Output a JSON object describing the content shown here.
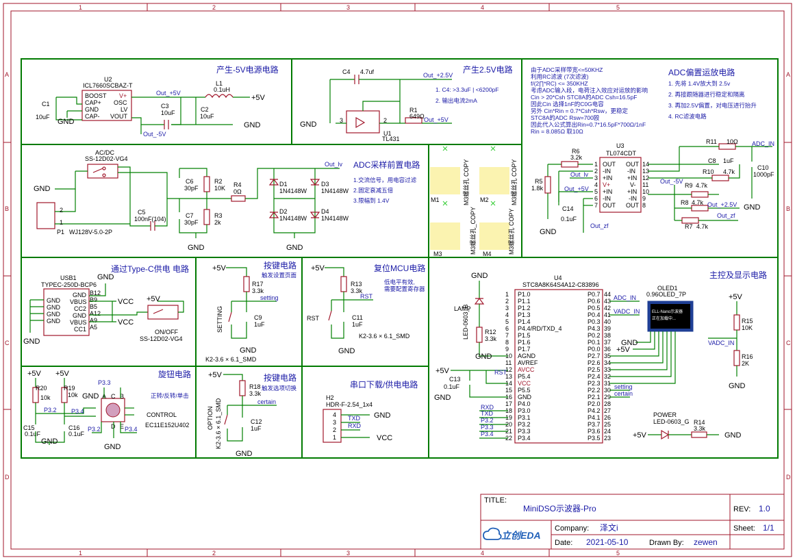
{
  "rulers": {
    "cols": [
      "1",
      "2",
      "3",
      "4",
      "5"
    ],
    "rows": [
      "A",
      "B",
      "C",
      "D"
    ]
  },
  "sections": {
    "neg5v": {
      "title": "产生-5V电源电路",
      "u2_ref": "U2",
      "u2_part": "ICL7660SCBAZ-T",
      "u2_left_pins": [
        "BOOST",
        "CAP+",
        "GND",
        "CAP-"
      ],
      "u2_right_pins": [
        "V+",
        "OSC",
        "LV",
        "VOUT"
      ],
      "c1": "C1",
      "c1_val": "10uF",
      "c3": "C3",
      "c3_val": "10uF",
      "c2": "C2",
      "c2_val": "10uF",
      "l1": "L1",
      "l1_val": "0.1uH",
      "net_out5v": "Out_+5V",
      "net_outm5v": "Out_-5V",
      "plus5v": "+5V",
      "gnd": "GND"
    },
    "v25": {
      "title": "产生2.5V电路",
      "c4": "C4",
      "c4_val": "4.7uf",
      "r1": "R1",
      "r1_val": "649Ω",
      "u1": "U1",
      "u1_part": "TL431",
      "net_out25": "Out_+2.5V",
      "net_out5": "Out_+5V",
      "notes": [
        "1. C4: >3.3uF | <6200pF",
        "2. 输出电流2mA"
      ],
      "gnd": "GND"
    },
    "adc_bias": {
      "title": "ADC偏置运放电路",
      "desc": [
        "由于ADC采样带宽<=50KHZ",
        "利用RC滤波 (7次滤波)",
        "f/(2∏*RC) <= 350KHZ",
        "考虑ADC输入段，电荷注入效应对运放的影响",
        "Cin > 20*Csh  STC8A的ADC Csh=16.5pF",
        "因此Cin 选择1nF的C0G电容",
        "另外 Cin*Rin = 0.7*Csh*Rsw，更稳定",
        "STC8A的ADC Rsw=700殴",
        "因此代入公式算出Rin=0.7*16.5pF*700Ω/1nF",
        "Rin = 8.085Ω  取10Ω"
      ],
      "steps": [
        "1. 先将   1.4V放大到   2.5v",
        "2. 再接跟随器进行稳定和隔离",
        "3. 再加2.5V偏置，对电压进行抬升",
        "4. RC滤波电路"
      ],
      "u3": "U3",
      "u3_part": "TL074CDT",
      "u3_left_pins": [
        [
          "OUT",
          "1"
        ],
        [
          "-IN",
          "2"
        ],
        [
          "+IN",
          "3"
        ],
        [
          "V+",
          "4"
        ],
        [
          "+IN",
          "5"
        ],
        [
          "-IN",
          "6"
        ],
        [
          "OUT",
          "7"
        ]
      ],
      "u3_right_pins": [
        [
          "14",
          "OUT"
        ],
        [
          "13",
          "-IN"
        ],
        [
          "12",
          "+IN"
        ],
        [
          "11",
          "V-"
        ],
        [
          "10",
          "+IN"
        ],
        [
          "9",
          "-IN"
        ],
        [
          "8",
          "OUT"
        ]
      ],
      "r5": "R5",
      "r5_val": "1.8k",
      "r6": "R6",
      "r6_val": "3.2k",
      "r7": "R7",
      "r7_val": "4.7k",
      "r8": "R8",
      "r8_val": "4.7k",
      "r9": "R9",
      "r9_val": "4.7k",
      "r10": "R10",
      "r10_val": "4.7k",
      "r11": "R11",
      "r11_val": "10Ω",
      "c8": "C8",
      "c8_val": "1uF",
      "c10": "C10",
      "c10_val": "1000pF",
      "c14": "C14",
      "c14_val": "0.1uF",
      "net_adcin": "ADC_IN",
      "net_outlv": "Out_lv",
      "net_out5": "Out_+5V",
      "net_outm5": "Out_-5V",
      "net_out25": "Out_+2.5V",
      "net_outzf": "Out_zf",
      "gnd": "GND"
    },
    "adc_front": {
      "title": "ADC采样前置电路",
      "notes": [
        "1.交流信号，用电容过滤",
        "2.固定衰减五倍",
        "3.限幅到     1.4V"
      ],
      "sw": "AC/DC",
      "sw_part": "SS-12D02-VG4",
      "p1": "P1",
      "p1_part": "WJ128V-5.0-2P",
      "c5": "C5",
      "c5_val": "100nF(104)",
      "c6": "C6",
      "c6_val": "30pF",
      "c7": "C7",
      "c7_val": "30pF",
      "r2": "R2",
      "r2_val": "10K",
      "r3": "R3",
      "r3_val": "2k",
      "r4": "R4",
      "r4_val": "0Ω",
      "d1": "D1",
      "d2": "D2",
      "d3": "D3",
      "d4": "D4",
      "d_part": "1N4148W",
      "net_outlv": "Out_lv",
      "gnd": "GND"
    },
    "holes": {
      "m1": "M1",
      "m2": "M2",
      "m3": "M3",
      "m4": "M4",
      "part": "M3螺丝孔 COPY",
      "part_alt": "M3螺丝孔_COPY"
    },
    "typec": {
      "title": "通过Type-C供电 电路",
      "usb": "USB1",
      "usb_part": "TYPEC-250D-BCP6",
      "left_pins": [
        "GND",
        "GND",
        "GND",
        "GND"
      ],
      "right_pins": [
        [
          "GND",
          "B12"
        ],
        [
          "VBUS",
          "B9"
        ],
        [
          "CC2",
          "B5"
        ],
        [
          "GND",
          "A12"
        ],
        [
          "VBUS",
          "A9"
        ],
        [
          "CC1",
          "A5"
        ]
      ],
      "vcc": "VCC",
      "plus5v": "+5V",
      "sw": "ON/OFF",
      "sw_part": "SS-12D02-VG4",
      "gnd": "GND"
    },
    "key_set": {
      "title": "按键电路",
      "sub": "触发设置页面",
      "r17": "R17",
      "r17_val": "3.3k",
      "c9": "C9",
      "c9_val": "1uF",
      "sw": "SETTING",
      "sw_part": "K2-3.6 × 6.1_SMD",
      "net": "setting",
      "plus5v": "+5V",
      "gnd": "GND"
    },
    "reset": {
      "title": "复位MCU电路",
      "sub1": "低电平有效,",
      "sub2": "需要配置寄存器",
      "r13": "R13",
      "r13_val": "3.3k",
      "c11": "C11",
      "c11_val": "1uF",
      "sw": "RST",
      "sw_part": "K2-3.6 × 6.1_SMD",
      "net": "RST",
      "plus5v": "+5V",
      "gnd": "GND"
    },
    "mcu": {
      "title": "主控及显示电路",
      "u4": "U4",
      "u4_part": "STC8A8K64S4A12-C83896",
      "left_pins": [
        [
          "1",
          "P1.0"
        ],
        [
          "2",
          "P1.1"
        ],
        [
          "3",
          "P1.2"
        ],
        [
          "4",
          "P1.3"
        ],
        [
          "5",
          "P1.4"
        ],
        [
          "6",
          "P4.4/RD/TXD_4"
        ],
        [
          "7",
          "P1.5"
        ],
        [
          "8",
          "P1.6"
        ],
        [
          "9",
          "P1.7"
        ],
        [
          "10",
          "AGND"
        ],
        [
          "11",
          "AVREF"
        ],
        [
          "12",
          "AVCC"
        ],
        [
          "13",
          "P5.4"
        ],
        [
          "14",
          "VCC"
        ],
        [
          "15",
          "P5.5"
        ],
        [
          "16",
          "GND"
        ],
        [
          "17",
          "P4.0"
        ],
        [
          "18",
          "P3.0"
        ],
        [
          "19",
          "P3.1"
        ],
        [
          "20",
          "P3.2"
        ],
        [
          "21",
          "P3.3"
        ],
        [
          "22",
          "P3.4"
        ]
      ],
      "right_pins": [
        [
          "44",
          "P0.7"
        ],
        [
          "43",
          "P0.6"
        ],
        [
          "42",
          "P0.5"
        ],
        [
          "41",
          "P0.4"
        ],
        [
          "40",
          "P0.3"
        ],
        [
          "39",
          "P4.3"
        ],
        [
          "38",
          "P0.2"
        ],
        [
          "37",
          "P0.1"
        ],
        [
          "36",
          "P0.0"
        ],
        [
          "35",
          "P2.7"
        ],
        [
          "34",
          "P2.6"
        ],
        [
          "33",
          "P2.5"
        ],
        [
          "32",
          "P2.4"
        ],
        [
          "31",
          "P2.3"
        ],
        [
          "30",
          "P2.2"
        ],
        [
          "29",
          "P2.1"
        ],
        [
          "28",
          "P2.0"
        ],
        [
          "27",
          "P4.2"
        ],
        [
          "26",
          "P4.1"
        ],
        [
          "25",
          "P3.7"
        ],
        [
          "24",
          "P3.6"
        ],
        [
          "23",
          "P3.5"
        ]
      ],
      "lamp": "LAMP",
      "led_part": "LED-0603_B",
      "r12": "R12",
      "r12_val": "3.3k",
      "c13": "C13",
      "c13_val": "0.1uF",
      "oled": "OLED1",
      "oled_part": "0.96OLED_7P",
      "oled_line1": "ELL-Nano示波器",
      "oled_line2": "正在加载中...",
      "r15": "R15",
      "r15_val": "10K",
      "r16": "R16",
      "r16_val": "2K",
      "power": "POWER",
      "power_part": "LED-0603_G",
      "r14": "R14",
      "r14_val": "3.3k",
      "nets": {
        "adc_in": "ADC_IN",
        "vadc_in": "VADC_IN",
        "rst": "RST",
        "rxd": "RXD",
        "txd": "TXD",
        "p32": "P3.2",
        "p33": "P3.3",
        "p34": "P3.4",
        "setting": "setting",
        "certain": "certain"
      },
      "plus5v": "+5V",
      "gnd": "GND"
    },
    "encoder": {
      "title": "旋钮电路",
      "sub": "正转/反转/单击",
      "r20": "R20",
      "r20_val": "10k",
      "r19": "R19",
      "r19_val": "10k",
      "c15": "C15",
      "c15_val": "0.1uF",
      "c16": "C16",
      "c16_val": "0.1uF",
      "control": "CONTROL",
      "part": "EC11E152U402",
      "pins": [
        "A",
        "C",
        "B",
        "D",
        "E"
      ],
      "net_p32": "P3.2",
      "net_p33": "P3.3",
      "net_p34": "P3.4",
      "plus5v": "+5V",
      "gnd": "GND"
    },
    "key_opt": {
      "title": "按键电路",
      "sub": "触发选项切换",
      "r18": "R18",
      "r18_val": "3.3k",
      "c12": "C12",
      "c12_val": "1uF",
      "sw": "OPTION",
      "sw_part": "K2-3.6 × 6.1_SMD",
      "net": "certain",
      "plus5v": "+5V",
      "gnd": "GND"
    },
    "download": {
      "title": "串口下载/供电电路",
      "h2": "H2",
      "h2_part": "HDR-F-2.54_1x4",
      "pins": [
        "4",
        "3",
        "2",
        "1"
      ],
      "txd": "TXD",
      "rxd": "RXD",
      "vcc": "VCC",
      "gnd": "GND"
    }
  },
  "title_block": {
    "title_label": "TITLE:",
    "title": "MiniDSO示波器-Pro",
    "rev_label": "REV:",
    "rev": "1.0",
    "company_label": "Company:",
    "company": "泽文i",
    "sheet_label": "Sheet:",
    "sheet": "1/1",
    "date_label": "Date:",
    "date": "2021-05-10",
    "drawn_label": "Drawn By:",
    "drawn": "zewen",
    "logo": "立创EDA"
  },
  "colors": {
    "frame": "#a0162a",
    "wire": "#008000",
    "text_blue": "#1a1aa6",
    "pad": "#fbf3b0"
  }
}
